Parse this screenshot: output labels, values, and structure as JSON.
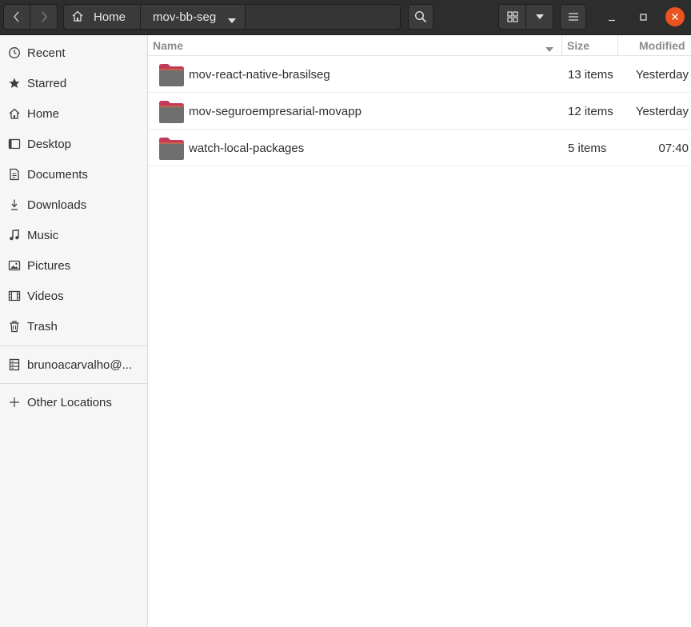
{
  "header": {
    "breadcrumbs": [
      {
        "label": "Home",
        "icon": "home-icon"
      },
      {
        "label": "mov-bb-seg"
      }
    ],
    "icons": {
      "back": "chevron-left-icon",
      "forward": "chevron-right-icon",
      "search": "search-icon",
      "view": "grid-view-icon",
      "view_options": "chevron-down-icon",
      "menu": "hamburger-menu-icon",
      "minimize": "minimize-icon",
      "maximize": "maximize-icon",
      "close": "close-icon"
    },
    "close_color": "#e95420"
  },
  "sidebar": {
    "items": [
      {
        "label": "Recent",
        "icon": "clock-icon"
      },
      {
        "label": "Starred",
        "icon": "star-icon"
      },
      {
        "label": "Home",
        "icon": "home-icon"
      },
      {
        "label": "Desktop",
        "icon": "desktop-icon"
      },
      {
        "label": "Documents",
        "icon": "document-icon"
      },
      {
        "label": "Downloads",
        "icon": "download-icon"
      },
      {
        "label": "Music",
        "icon": "music-icon"
      },
      {
        "label": "Pictures",
        "icon": "picture-icon"
      },
      {
        "label": "Videos",
        "icon": "video-icon"
      },
      {
        "label": "Trash",
        "icon": "trash-icon"
      }
    ],
    "network_item": {
      "label": "brunoacarvalho@...",
      "icon": "server-icon"
    },
    "other_locations": {
      "label": "Other Locations",
      "icon": "plus-icon"
    }
  },
  "list": {
    "columns": {
      "name": "Name",
      "size": "Size",
      "modified": "Modified"
    },
    "rows": [
      {
        "name": "mov-react-native-brasilseg",
        "size": "13 items",
        "modified": "Yesterday"
      },
      {
        "name": "mov-seguroempresarial-movapp",
        "size": "12 items",
        "modified": "Yesterday"
      },
      {
        "name": "watch-local-packages",
        "size": "5 items",
        "modified": "07:40"
      }
    ]
  }
}
